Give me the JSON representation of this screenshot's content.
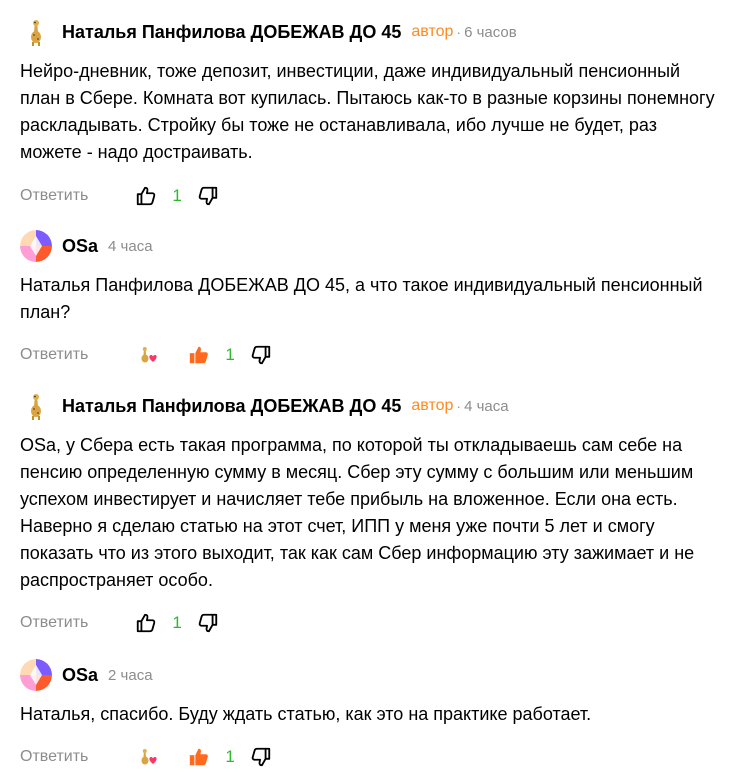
{
  "comments": [
    {
      "author": "Наталья Панфилова ДОБЕЖАВ ДО 45",
      "badge": "автор",
      "time": "6 часов",
      "text": "Нейро-дневник, тоже депозит, инвестиции, даже индивидуальный пенсионный план в Сбере. Комната вот купилась. Пытаюсь как-то в разные корзины понемногу раскладывать. Стройку бы тоже не останавливала, ибо лучше не будет, раз можете - надо достраивать.",
      "reply_label": "Ответить",
      "likes": "1"
    },
    {
      "author": "OSa",
      "time": "4 часа",
      "text": "Наталья Панфилова ДОБЕЖАВ ДО 45, а что такое индивидуальный пенсионный план?",
      "reply_label": "Ответить",
      "likes": "1"
    },
    {
      "author": "Наталья Панфилова ДОБЕЖАВ ДО 45",
      "badge": "автор",
      "time": "4 часа",
      "text": "OSa, у Сбера есть такая программа, по которой ты откладываешь сам себе на пенсию определенную сумму в месяц. Сбер эту сумму с большим или меньшим успехом инвестирует и начисляет тебе прибыль на вложенное. Если она есть. Наверно я сделаю статью на этот счет, ИПП у меня уже почти 5 лет и смогу показать что из этого выходит, так как сам Сбер информацию эту зажимает и не распространяет особо.",
      "reply_label": "Ответить",
      "likes": "1"
    },
    {
      "author": "OSa",
      "time": "2 часа",
      "text": "Наталья, спасибо. Буду ждать статью, как это на практике работает.",
      "reply_label": "Ответить",
      "likes": "1"
    }
  ],
  "colors": {
    "badge": "#ff8a1f",
    "like_active": "#ff6a1f",
    "count": "#2eb82e",
    "muted": "#8c8c8c"
  }
}
